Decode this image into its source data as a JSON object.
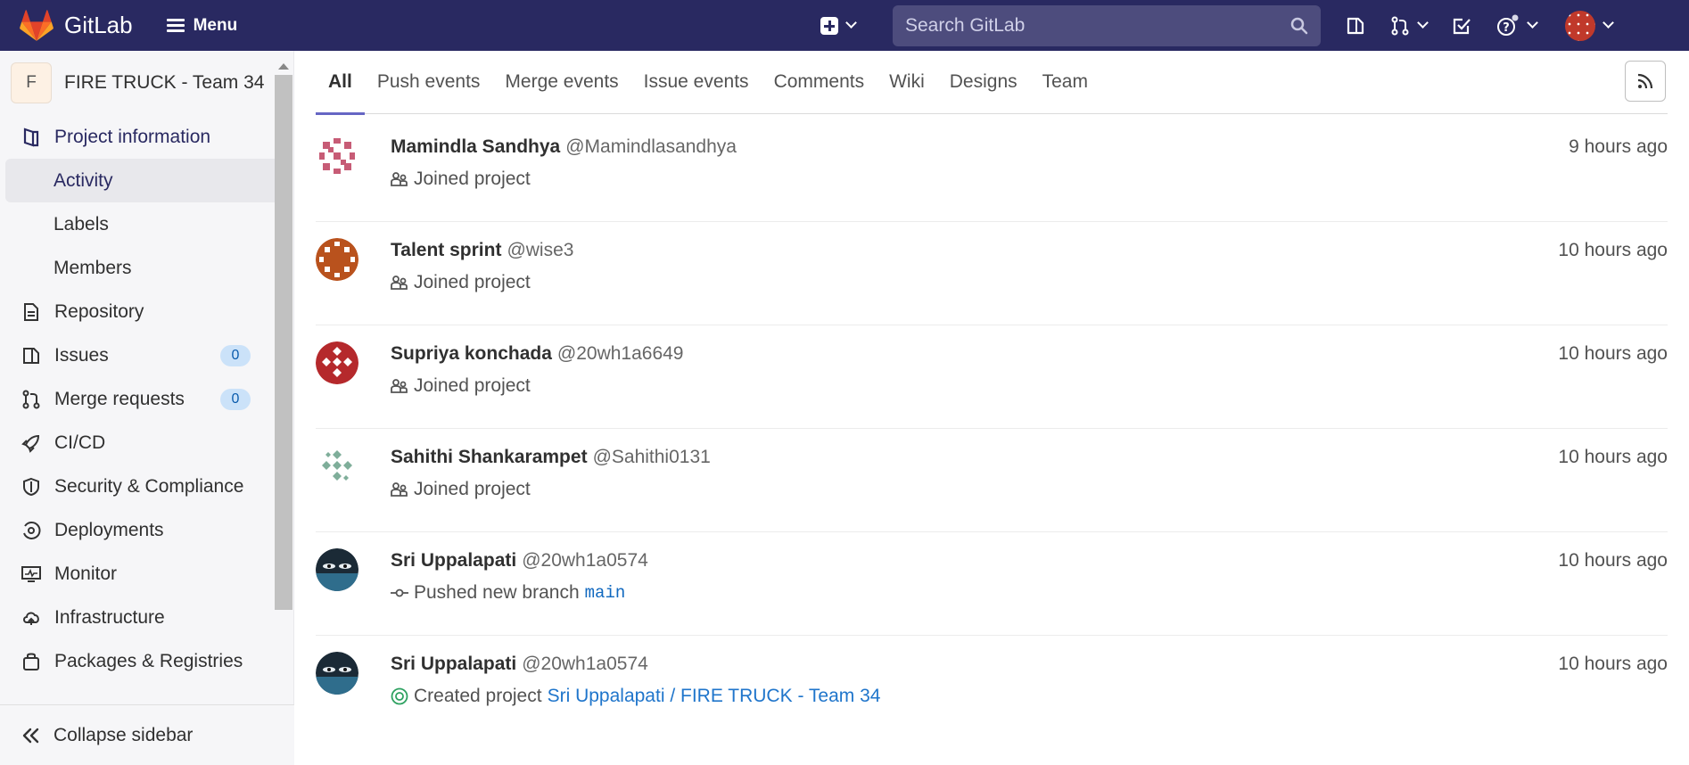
{
  "header": {
    "brand": "GitLab",
    "menu_label": "Menu",
    "search_placeholder": "Search GitLab",
    "brand_color": "#292961"
  },
  "sidebar": {
    "project_initial": "F",
    "project_name": "FIRE TRUCK - Team 34",
    "section_label": "Project information",
    "sub_items": [
      "Activity",
      "Labels",
      "Members"
    ],
    "items": [
      {
        "label": "Repository",
        "icon": "document-icon"
      },
      {
        "label": "Issues",
        "icon": "issues-icon",
        "badge": "0"
      },
      {
        "label": "Merge requests",
        "icon": "merge-request-icon",
        "badge": "0"
      },
      {
        "label": "CI/CD",
        "icon": "rocket-icon"
      },
      {
        "label": "Security & Compliance",
        "icon": "shield-icon"
      },
      {
        "label": "Deployments",
        "icon": "deployments-icon"
      },
      {
        "label": "Monitor",
        "icon": "monitor-icon"
      },
      {
        "label": "Infrastructure",
        "icon": "cloud-icon"
      },
      {
        "label": "Packages & Registries",
        "icon": "package-icon"
      }
    ],
    "collapse_label": "Collapse sidebar"
  },
  "tabs": [
    "All",
    "Push events",
    "Merge events",
    "Issue events",
    "Comments",
    "Wiki",
    "Designs",
    "Team"
  ],
  "events": [
    {
      "name": "Mamindla Sandhya",
      "handle": "@Mamindlasandhya",
      "action": "Joined project",
      "time": "9 hours ago"
    },
    {
      "name": "Talent sprint",
      "handle": "@wise3",
      "action": "Joined project",
      "time": "10 hours ago"
    },
    {
      "name": "Supriya konchada",
      "handle": "@20wh1a6649",
      "action": "Joined project",
      "time": "10 hours ago"
    },
    {
      "name": "Sahithi Shankarampet",
      "handle": "@Sahithi0131",
      "action": "Joined project",
      "time": "10 hours ago"
    },
    {
      "name": "Sri Uppalapati",
      "handle": "@20wh1a0574",
      "action": "Pushed new branch",
      "branch": "main",
      "time": "10 hours ago"
    },
    {
      "name": "Sri Uppalapati",
      "handle": "@20wh1a0574",
      "action": "Created project",
      "project_link": "Sri Uppalapati / FIRE TRUCK - Team 34",
      "time": "10 hours ago"
    }
  ]
}
